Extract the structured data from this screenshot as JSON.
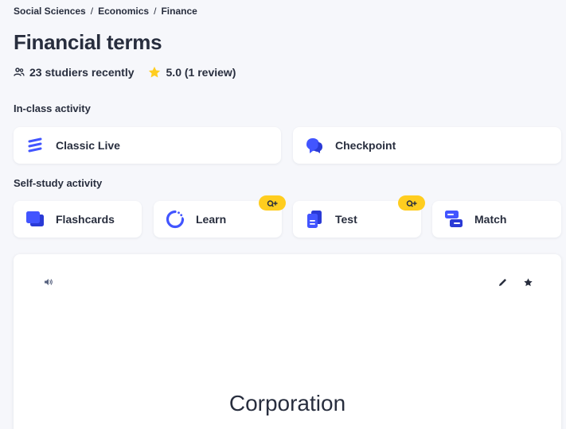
{
  "breadcrumb": {
    "items": [
      "Social Sciences",
      "Economics",
      "Finance"
    ],
    "separator": "/"
  },
  "set": {
    "title": "Financial terms",
    "studiers": "23 studiers recently",
    "rating": "5.0 (1 review)"
  },
  "sections": {
    "in_class": "In-class activity",
    "self_study": "Self-study activity"
  },
  "in_class_activities": [
    {
      "label": "Classic Live",
      "icon": "classic-live-icon"
    },
    {
      "label": "Checkpoint",
      "icon": "checkpoint-icon"
    }
  ],
  "self_study_activities": [
    {
      "label": "Flashcards",
      "icon": "flashcards-icon",
      "premium": false
    },
    {
      "label": "Learn",
      "icon": "learn-icon",
      "premium": true
    },
    {
      "label": "Test",
      "icon": "test-icon",
      "premium": true
    },
    {
      "label": "Match",
      "icon": "match-icon",
      "premium": false
    }
  ],
  "flashcard": {
    "term": "Corporation"
  },
  "colors": {
    "accent": "#4255ff",
    "badge": "#ffcd1f",
    "star": "#ffcd1f",
    "text": "#282e3e",
    "background": "#f6f7fb"
  }
}
